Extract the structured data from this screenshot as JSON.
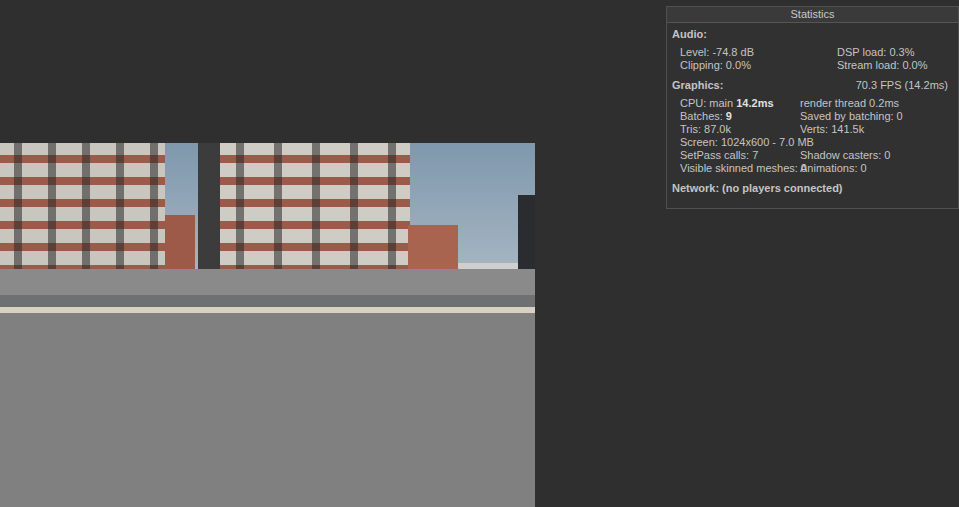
{
  "panel": {
    "title": "Statistics"
  },
  "sections": [
    {
      "title": "Audio:",
      "aside": "",
      "kind": "audio",
      "rows": [
        [
          [
            {
              "text": "Level: -74.8 dB",
              "bold": false
            }
          ],
          [
            {
              "text": "DSP load: 0.3%",
              "bold": false
            }
          ]
        ],
        [
          [
            {
              "text": "Clipping: 0.0%",
              "bold": false
            }
          ],
          [
            {
              "text": "Stream load: 0.0%",
              "bold": false
            }
          ]
        ]
      ]
    },
    {
      "title": "Graphics:",
      "aside": "70.3 FPS (14.2ms)",
      "kind": "graphics",
      "rows": [
        [
          [
            {
              "text": "CPU: main ",
              "bold": false
            },
            {
              "text": "14.2ms",
              "bold": true
            }
          ],
          [
            {
              "text": "render thread 0.2ms",
              "bold": false
            }
          ]
        ],
        [
          [
            {
              "text": "Batches: ",
              "bold": false
            },
            {
              "text": "9",
              "bold": true
            }
          ],
          [
            {
              "text": "Saved by batching: 0",
              "bold": false
            }
          ]
        ],
        [
          [
            {
              "text": "Tris: 87.0k",
              "bold": false
            }
          ],
          [
            {
              "text": "Verts: 141.5k",
              "bold": false
            }
          ]
        ],
        [
          [
            {
              "text": "Screen: 1024x600 - 7.0 MB",
              "bold": false
            }
          ]
        ],
        [
          [
            {
              "text": "SetPass calls: 7",
              "bold": false
            }
          ],
          [
            {
              "text": "Shadow casters: 0",
              "bold": false
            }
          ]
        ],
        [
          [
            {
              "text": "Visible skinned meshes: 0",
              "bold": false
            }
          ],
          [
            {
              "text": "Animations: 0",
              "bold": false
            }
          ]
        ]
      ]
    }
  ],
  "network": "Network: (no players connected)"
}
